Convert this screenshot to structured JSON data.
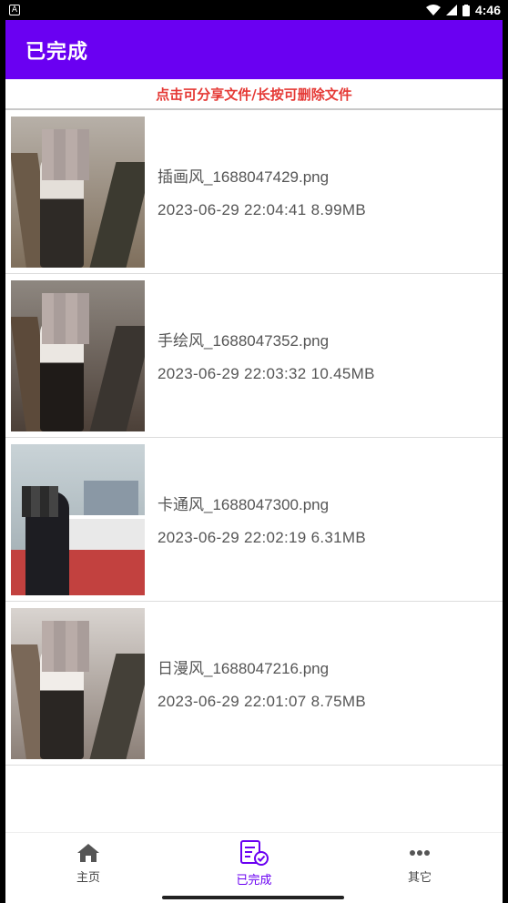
{
  "status_bar": {
    "time": "4:46",
    "notification_icon": "A"
  },
  "app_bar": {
    "title": "已完成"
  },
  "hint": {
    "text": "点击可分享文件/长按可删除文件"
  },
  "files": [
    {
      "name": "插画风_1688047429.png",
      "meta": "2023-06-29 22:04:41   8.99MB",
      "style": "illustration"
    },
    {
      "name": "手绘风_1688047352.png",
      "meta": "2023-06-29 22:03:32   10.45MB",
      "style": "handdrawn"
    },
    {
      "name": "卡通风_1688047300.png",
      "meta": "2023-06-29 22:02:19   6.31MB",
      "style": "cartoon"
    },
    {
      "name": "日漫风_1688047216.png",
      "meta": "2023-06-29 22:01:07   8.75MB",
      "style": "anime"
    }
  ],
  "bottom_nav": {
    "items": [
      {
        "label": "主页",
        "icon": "home-icon",
        "active": false
      },
      {
        "label": "已完成",
        "icon": "completed-list-icon",
        "active": true
      },
      {
        "label": "其它",
        "icon": "more-icon",
        "active": false
      }
    ]
  },
  "colors": {
    "primary": "#6a00f2",
    "hint": "#e53935"
  }
}
